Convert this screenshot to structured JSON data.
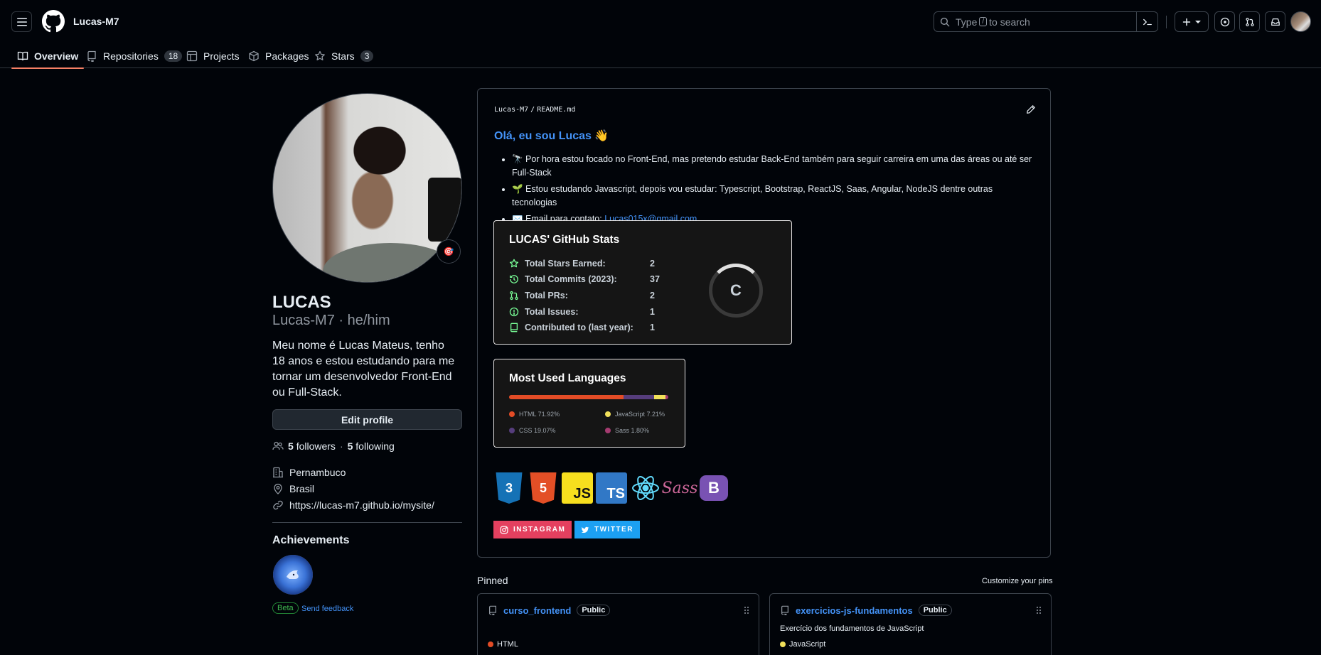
{
  "header": {
    "username": "Lucas-M7",
    "search_placeholder_pre": "Type",
    "search_key": "/",
    "search_placeholder_post": "to search"
  },
  "tabs": [
    {
      "label": "Overview"
    },
    {
      "label": "Repositories",
      "count": "18"
    },
    {
      "label": "Projects"
    },
    {
      "label": "Packages"
    },
    {
      "label": "Stars",
      "count": "3"
    }
  ],
  "profile": {
    "name": "LUCAS",
    "login": "Lucas-M7 · he/him",
    "bio": "Meu nome é Lucas Mateus, tenho 18 anos e estou estudando para me tornar um desenvolvedor Front-End ou Full-Stack.",
    "edit_label": "Edit profile",
    "followers": "5",
    "followers_label": "followers",
    "following": "5",
    "following_label": "following",
    "company": "Pernambuco",
    "location": "Brasil",
    "website": "https://lucas-m7.github.io/mysite/",
    "achievements_title": "Achievements",
    "beta": "Beta",
    "feedback": "Send feedback"
  },
  "readme": {
    "path_user": "Lucas-M7",
    "path_sep": "/",
    "path_file": "README.md",
    "greeting": "Olá, eu sou Lucas 👋",
    "bullets": [
      "🔭 Por hora estou focado no Front-End, mas pretendo estudar Back-End também para seguir carreira em uma das áreas ou até ser Full-Stack",
      "🌱 Estou estudando Javascript, depois vou estudar: Typescript, Bootstrap, ReactJS, Saas, Angular, NodeJS dentre outras tecnologias"
    ],
    "email_prefix": "✉️ Email para contato:",
    "email": "Lucas015x@gmail.com",
    "stats": {
      "title": "LUCAS' GitHub Stats",
      "rows": [
        {
          "label": "Total Stars Earned:",
          "value": "2"
        },
        {
          "label": "Total Commits (2023):",
          "value": "37"
        },
        {
          "label": "Total PRs:",
          "value": "2"
        },
        {
          "label": "Total Issues:",
          "value": "1"
        },
        {
          "label": "Contributed to (last year):",
          "value": "1"
        }
      ],
      "rank": "C"
    },
    "languages": {
      "title": "Most Used Languages",
      "items": [
        {
          "label": "HTML 71.92%",
          "percent": 71.92,
          "color": "#e34c26"
        },
        {
          "label": "CSS 19.07%",
          "percent": 19.07,
          "color": "#563d7c"
        },
        {
          "label": "JavaScript 7.21%",
          "percent": 7.21,
          "color": "#f1e05a"
        },
        {
          "label": "Sass 1.80%",
          "percent": 1.8,
          "color": "#a53b70"
        }
      ]
    },
    "skills": [
      "CSS3",
      "HTML5",
      "JS",
      "TS",
      "React",
      "Sass",
      "B"
    ],
    "instagram": "INSTAGRAM",
    "twitter": "TWITTER"
  },
  "pinned": {
    "title": "Pinned",
    "customize": "Customize your pins",
    "repos": [
      {
        "name": "curso_frontend",
        "visibility": "Public",
        "description": "",
        "language": "HTML",
        "color": "#e34c26"
      },
      {
        "name": "exercicios-js-fundamentos",
        "visibility": "Public",
        "description": "Exercício dos fundamentos de JavaScript",
        "language": "JavaScript",
        "color": "#f1e05a"
      }
    ]
  }
}
